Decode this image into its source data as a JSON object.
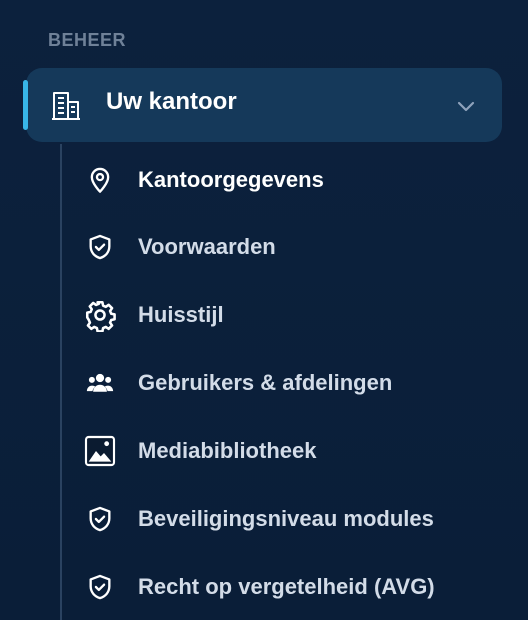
{
  "section": {
    "label": "BEHEER"
  },
  "group": {
    "title": "Uw kantoor",
    "icon": "building-icon",
    "expanded": true,
    "accent_color": "#38b6e8"
  },
  "items": [
    {
      "label": "Kantoorgegevens",
      "icon": "location-pin-icon",
      "active": true
    },
    {
      "label": "Voorwaarden",
      "icon": "shield-check-icon",
      "active": false
    },
    {
      "label": "Huisstijl",
      "icon": "gear-icon",
      "active": false
    },
    {
      "label": "Gebruikers & afdelingen",
      "icon": "users-icon",
      "active": false
    },
    {
      "label": "Mediabibliotheek",
      "icon": "image-icon",
      "active": false
    },
    {
      "label": "Beveiligingsniveau modules",
      "icon": "shield-check-icon",
      "active": false
    },
    {
      "label": "Recht op vergetelheid (AVG)",
      "icon": "shield-check-icon",
      "active": false
    }
  ],
  "colors": {
    "background": "#0b1f3a",
    "group_background": "#15395a",
    "text": "#d3dce8",
    "muted": "#6f8198"
  }
}
